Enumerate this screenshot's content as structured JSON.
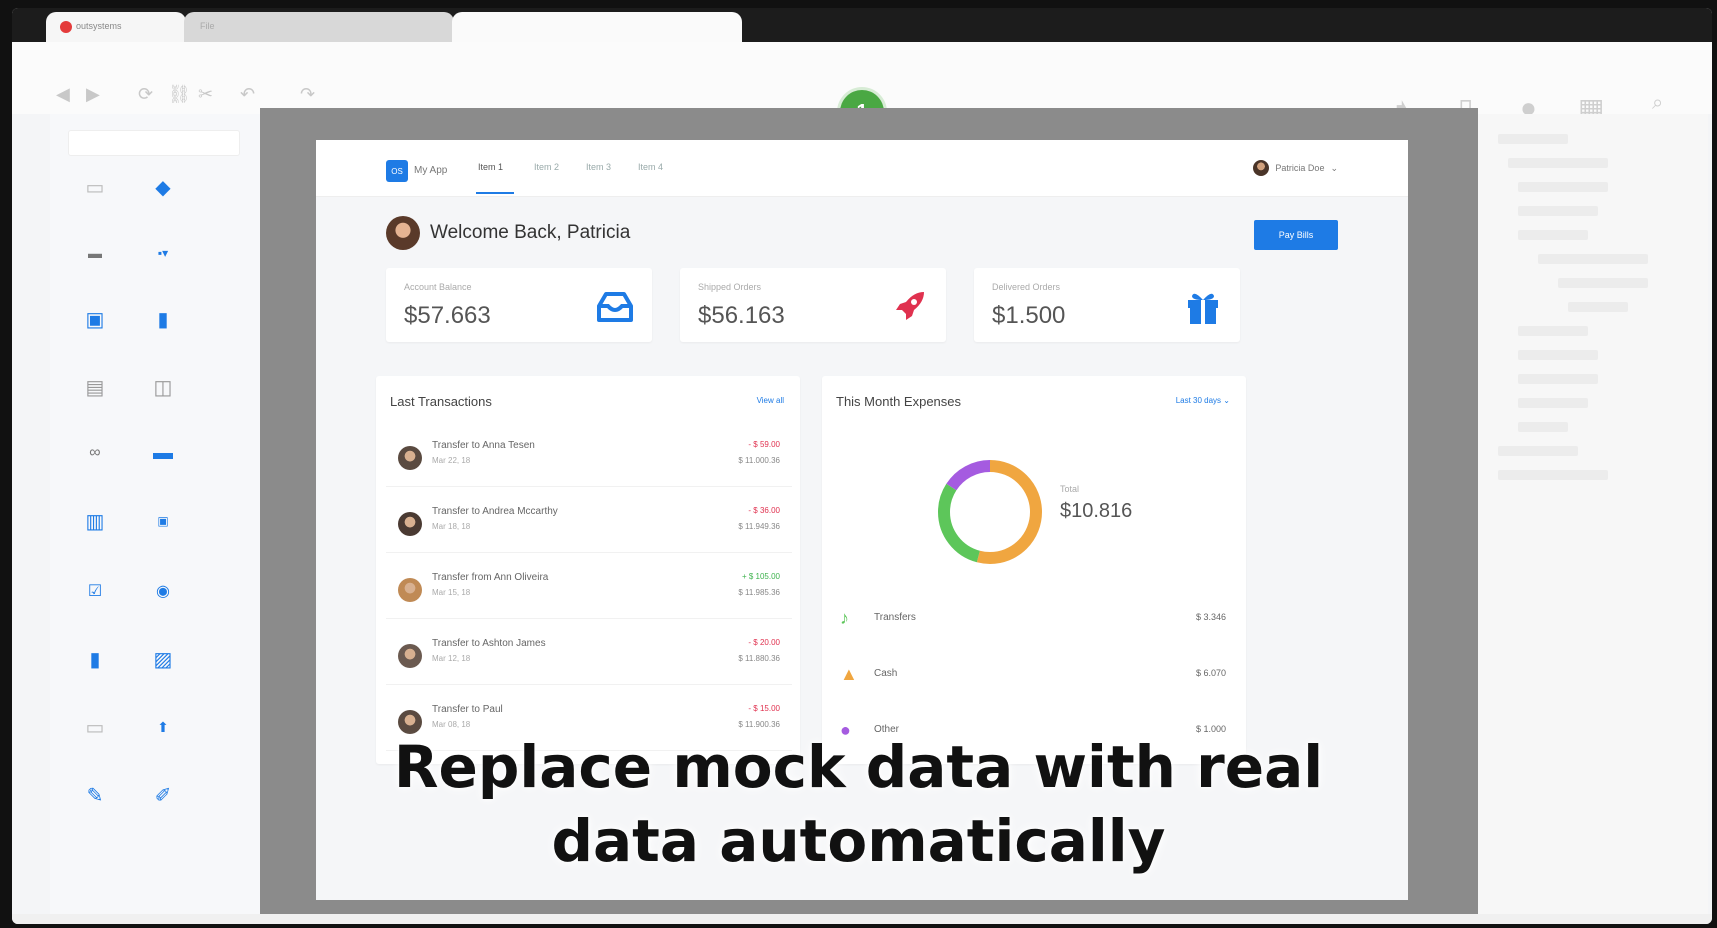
{
  "browser": {
    "tabs": [
      {
        "label": "outsystems"
      },
      {
        "label": "File"
      },
      {
        "label": ""
      }
    ]
  },
  "toolbar": {
    "page_badge": "1",
    "left_icons": [
      "back-icon",
      "forward-icon",
      "refresh-icon",
      "link-icon",
      "unlink-icon",
      "undo-icon",
      "redo-icon"
    ],
    "right_icons": [
      "tag-icon",
      "mobile-icon",
      "globe-icon",
      "grid-icon",
      "search-icon"
    ]
  },
  "widgets": [
    "container-icon",
    "if-icon",
    "text-icon",
    "expression-icon",
    "input-icon",
    "form-icon",
    "table-icon",
    "popup-icon",
    "link-widget-icon",
    "button-icon",
    "columns-icon",
    "date-icon",
    "checkbox-icon",
    "radio-icon",
    "list-icon",
    "image-icon",
    "calendar-icon",
    "upload-icon",
    "brush-icon",
    "style-icon"
  ],
  "app": {
    "logo": "OS",
    "name": "My App",
    "nav": [
      "Item 1",
      "Item 2",
      "Item 3",
      "Item 4"
    ],
    "user": "Patricia Doe",
    "welcome": "Welcome Back, Patricia",
    "pay_button": "Pay Bills",
    "stats": [
      {
        "label": "Account Balance",
        "value": "$57.663",
        "icon": "inbox-icon",
        "color": "#1e7be5"
      },
      {
        "label": "Shipped Orders",
        "value": "$56.163",
        "icon": "rocket-icon",
        "color": "#e0314f"
      },
      {
        "label": "Delivered Orders",
        "value": "$1.500",
        "icon": "gift-icon",
        "color": "#1e7be5"
      }
    ],
    "transactions": {
      "title": "Last Transactions",
      "link": "View all",
      "rows": [
        {
          "title": "Transfer to Anna Tesen",
          "date": "Mar 22, 18",
          "amount": "- $ 59.00",
          "balance": "$ 11.000.36",
          "type": "out"
        },
        {
          "title": "Transfer to Andrea Mccarthy",
          "date": "Mar 18, 18",
          "amount": "- $ 36.00",
          "balance": "$ 11.949.36",
          "type": "out"
        },
        {
          "title": "Transfer from Ann Oliveira",
          "date": "Mar 15, 18",
          "amount": "+ $ 105.00",
          "balance": "$ 11.985.36",
          "type": "in"
        },
        {
          "title": "Transfer to Ashton James",
          "date": "Mar 12, 18",
          "amount": "- $ 20.00",
          "balance": "$ 11.880.36",
          "type": "out"
        },
        {
          "title": "Transfer to Paul",
          "date": "Mar 08, 18",
          "amount": "- $ 15.00",
          "balance": "$ 11.900.36",
          "type": "out"
        }
      ]
    },
    "expenses": {
      "title": "This Month Expenses",
      "filter": "Last 30 days",
      "total_label": "Total",
      "total": "$10.816",
      "donut": [
        {
          "name": "Transfers",
          "fraction": 0.54,
          "color": "#f0a640"
        },
        {
          "name": "Cash",
          "fraction": 0.3,
          "color": "#5dc65a"
        },
        {
          "name": "Other",
          "fraction": 0.16,
          "color": "#a55be0"
        }
      ],
      "rows": [
        {
          "name": "Transfers",
          "value": "$ 3.346",
          "icon": "music-icon",
          "color": "#5dc65a"
        },
        {
          "name": "Cash",
          "value": "$ 6.070",
          "icon": "bell-icon",
          "color": "#f0a640"
        },
        {
          "name": "Other",
          "value": "$ 1.000",
          "icon": "dot-icon",
          "color": "#a55be0"
        }
      ]
    }
  },
  "caption": {
    "line1": "Replace mock data with real",
    "line2": "data automatically"
  }
}
